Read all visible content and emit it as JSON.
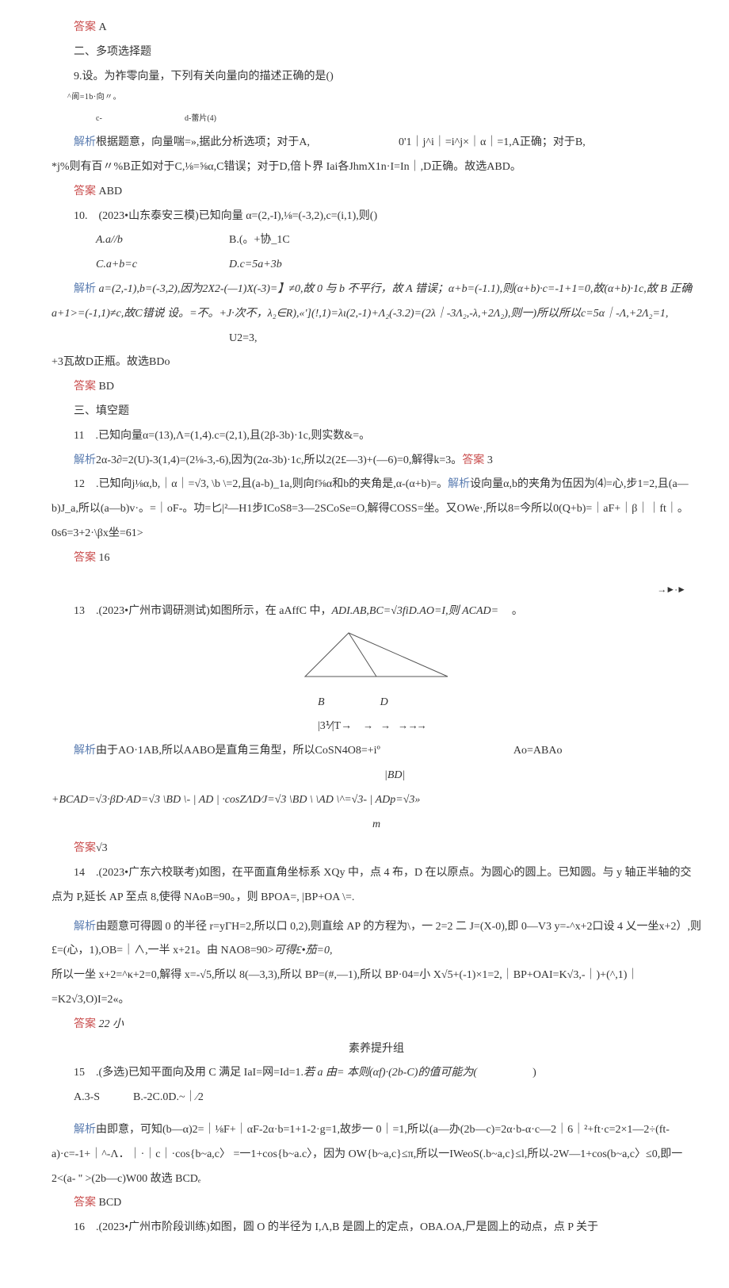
{
  "q8": {
    "alabel": "答案",
    "atext": "A"
  },
  "sec2": {
    "title": "二、多项选择题"
  },
  "q9": {
    "stem": "9.设。为祚零向量，下列有关向量向的描述正确的是()",
    "optA": "^阆=1b·向〃。",
    "optC": "c-",
    "optD": "d-蕾片(4)",
    "jx_label": "解析",
    "jx1": "根据题意，向量喘=»,据此分析选项；对于A,",
    "jx2": "0'1｜j^i｜=i^j×｜α｜=1,A正确；对于B,",
    "jx3": "*j%则有百〃%B正如对于C,⅛=⅝α,C错误；对于D,倍卜界 Iai各JhmX1n·I=In｜,D正确。故选ABD。",
    "alabel": "答案",
    "atext": "ABD"
  },
  "q10": {
    "stem": "10.　(2023•山东泰安三模)已知向量 α=(2,-I),⅛=(-3,2),c=(i,1),则()",
    "optA": "A.a//b",
    "optB": "B.(。+协_1C",
    "optC": "C.a+b=c",
    "optD": "D.c=5a+3b",
    "jx_label": "解析",
    "jx": " a=(2,-1),b=(-3,2),因为2X2-(—1)X(-3)=】≠0,故 0 与 b 不平行，故 A 错误；α+b=(-1.1),则(α+b)·c=-1+1=0,故(α+b)·1c,故 B 正确 a+1>=(-1,1)≠c,故C错说 设。=不。+J·次不，λ₂∈R),«'](!,1)=λι(2,-1)+Λ₂(-3.2)=(2λ｜-3Λ₂,-λ,+2Λ₂),则一)所以所以c=5α｜-Λ,+2Λ₂=1,",
    "jx_u": "U2=3,",
    "jx2": "+3瓦故D正瓶。故选BDo",
    "alabel": "答案",
    "atext": "BD"
  },
  "sec3": {
    "title": "三、填空题"
  },
  "q11": {
    "stem": "11　.已知向量α=(13),Λ=(1,4).c=(2,1),且(2β-3b)·1c,则实数&=。",
    "jx_label": "解析",
    "jx": "2α-3∂=2(U)-3(1,4)=(2⅛-3,-6),因为(2α-3b)·1c,所以2(2£—3)+(—6)=0,解得k=3。",
    "alabel": "答案",
    "atext": "3"
  },
  "q12": {
    "stem": "12　.已知向j⅛α,b,｜α｜=√3, \\b \\=2,且(a-b)_1a,则向f⅝α和b的夹角是,α-(α+b)=。",
    "jx_label": "解析",
    "jx": "设向量α,b的夹角为伍因为⑷=心,步1=2,且(a—b)J_a,所以(a—b)v·。=｜oF-。功=匕|²—H1步ICoS8=3—2SCoSe=O,解得COSS=坐。又OWe·,所以8=今所以0(Q+b)=｜aF+｜β｜｜ft｜。0s6=3+2·\\βx坐=61>",
    "alabel": "答案",
    "atext": "16"
  },
  "q13": {
    "stem_a": "13　.(2023•广州市调研测试)如图所示，在 aAffC 中，",
    "stem_b": "ADI.AB,BC=√3fiD.AO=I,则 ACAD=",
    "stem_c": "。",
    "fig_labels": {
      "B": "B",
      "D": "D"
    },
    "frac": "|3⅟|T→",
    "arrows": "→　→　→ →→",
    "frac_d": "|BD|",
    "ao_abao": "Ao=ABAo",
    "jx_label": "解析",
    "jx1": "由于AO·1AB,所以AABO是直角三角型，所以CoSN4O8=+iº",
    "jx2": "+BCAD=√3·βD·AD=√3 \\BD \\- | AD | ·cosZΛD⁄J=√3 \\BD \\ \\AD \\^=√3- | ADp=√3»",
    "m": "m",
    "alabel": "答案",
    "atext": "√3"
  },
  "q14": {
    "stem": "14　.(2023•广东六校联考)如图，在平面直角坐标系 XQy 中，点 4 布，D 在以原点。为圆心的圆上。已知圆。与 y 轴正半轴的交点为 P,延长 AP 至点 8,使得 NAoB=90。，则 BPOA=, |BP+OA \\=.",
    "jx_label": "解析",
    "jx1": "由题意可得圆 0 的半径 r=yΓH=2,所以口 0,2),则直绘 AP 的方程为\\，一 2=2 二 J=(X-0),即 0—V3 y=-^x+2口设 4 乂一坐x+2）,则£=(心，1),OB=｜∧,一半 x+21。由 NAO8=90>",
    "jx_mid": "可得£•茄=0,",
    "jx2": "所以一坐 x+2=^κ+2=0,解得 x=-√5,所以 8(—3,3),所以 BP=(#,—1),所以 BP·04=小 X√5+(-1)×1=2,｜BP+OAI=K√3,-｜)+(^,1)｜=K2√3,O)I=2«。",
    "alabel": "答案",
    "atext": "22 小"
  },
  "upgroup": {
    "title": "素养提升组"
  },
  "q15": {
    "stem_a": "15　.(多选)已知平面向及用 C 满足 IaI=网=Id=1.",
    "stem_b": "若 a 由= 本则(αf)·(2b-C)的值可能为(",
    "stem_c": ")",
    "opts": "A.3-S　　　B.-2C.0D.~｜⁄2",
    "jx_label": "解析",
    "jx": "由即意，可知(b—α)2=｜⅛F+｜αF-2α·b=1+1-2·g=1,故步一 0｜=1,所以(a—办(2b—c)=2α·b-α·c—2｜6｜²+ft·c=2×1—2÷(ft-a)·c=-1+｜^-Λ．｜·｜c｜·cos{b~a,c〉 =一1+cos{b~a.c〉，因为 OW{b~a,c}≤π,所以一IWeoS(.b~a,c}≤l,所以-2W—1+cos(b~a,c〉≤0,即一 2<(a- '' >(2b—c)W00 故选 BCDₑ",
    "alabel": "答案",
    "atext": "BCD"
  },
  "q16": {
    "stem": "16　.(2023•广州市阶段训练)如图，圆 O 的半径为 I,Λ,B 是圆上的定点，OBA.OA,尸是圆上的动点，点 P 关于"
  }
}
